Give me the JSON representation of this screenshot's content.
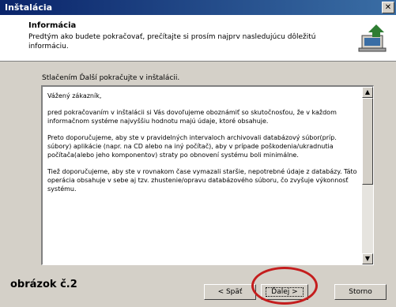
{
  "window": {
    "title": "Inštalácia",
    "close_glyph": "✕"
  },
  "header": {
    "title": "Informácia",
    "description": "Predtým ako budete pokračovať, prečítajte si prosím najprv nasledujúcu dôležitú informáciu."
  },
  "instruction": "Stlačením Ďalší pokračujte v inštalácii.",
  "textarea": {
    "paragraphs": [
      "Vážený zákazník,",
      "pred pokračovaním v inštalácii si Vás dovoľujeme oboznámiť so skutočnosťou, že v každom informačnom systéme najvyššiu hodnotu majú údaje, ktoré obsahuje.",
      "Preto doporučujeme, aby ste v pravidelných intervaloch archivovali databázový súbor(príp. súbory) aplikácie (napr. na CD alebo na iný počítač), aby v prípade poškodenia/ukradnutia počítača(alebo jeho komponentov) straty po obnovení systému boli minimálne.",
      "Tiež doporučujeme, aby ste v rovnakom čase vymazali staršie, nepotrebné údaje z databázy. Táto operácia obsahuje v sebe aj tzv. zhustenie/opravu databázového súboru, čo zvyšuje výkonnosť systému."
    ]
  },
  "icons": {
    "installer": "installer-computer-icon",
    "scroll_up": "▲",
    "scroll_down": "▼"
  },
  "buttons": {
    "back": "< Späť",
    "next": "Ďalej >",
    "cancel": "Storno"
  },
  "caption": "obrázok č.2",
  "colors": {
    "titlebar_start": "#0a246a",
    "titlebar_end": "#3a6ea5",
    "annotation_circle": "#c41d1d"
  }
}
